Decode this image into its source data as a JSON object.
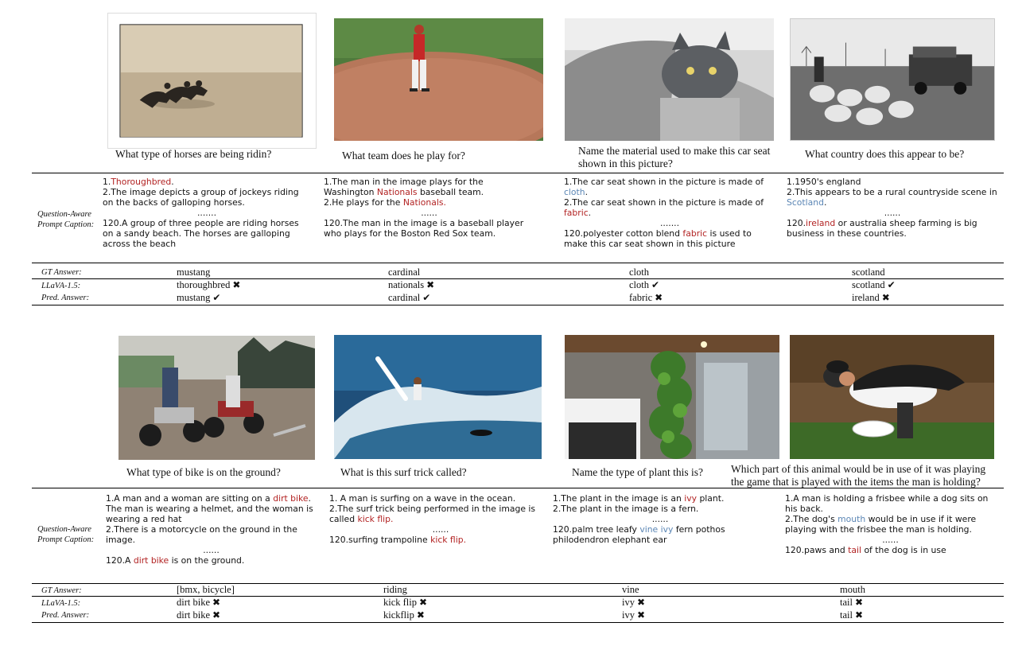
{
  "labels": {
    "caption": "Question-Aware Prompt Caption:",
    "gt": "GT Answer:",
    "llava": "LLaVA-1.5:",
    "pred": "Pred. Answer:"
  },
  "marks": {
    "correct": "✔",
    "wrong": "✖"
  },
  "examples": [
    {
      "image": "horses-racing-on-beach",
      "question": "What type of horses are being ridin?",
      "caption": [
        [
          {
            "t": "1."
          },
          {
            "t": "Thoroughbred",
            "c": "red"
          },
          {
            "t": "."
          }
        ],
        [
          {
            "t": "2.The image depicts a group of jockeys riding on the backs of galloping horses."
          }
        ],
        [
          {
            "t": "......."
          }
        ],
        [
          {
            "t": "120.A group of three people are riding horses on a sandy beach. The horses are galloping across the beach"
          }
        ]
      ],
      "gt": "mustang",
      "llava": "thoroughbred",
      "llava_ok": false,
      "pred": "mustang",
      "pred_ok": true
    },
    {
      "image": "baseball-pitcher-on-mound",
      "question": "What team does he play for?",
      "caption": [
        [
          {
            "t": "1.The man in the image plays for the Washington "
          },
          {
            "t": "Nationals",
            "c": "red"
          },
          {
            "t": " baseball team."
          }
        ],
        [
          {
            "t": "2.He plays for the "
          },
          {
            "t": "Nationals.",
            "c": "red"
          }
        ],
        [
          {
            "t": "......"
          }
        ],
        [
          {
            "t": "120.The man in the image is a baseball player who plays for the Boston Red Sox team."
          }
        ]
      ],
      "gt": "cardinal",
      "llava": "nationals",
      "llava_ok": false,
      "pred": "cardinal",
      "pred_ok": true
    },
    {
      "image": "cat-on-car-seat",
      "question": "Name the material used to make this car seat shown in this picture?",
      "caption": [
        [
          {
            "t": "1.The car seat shown in the picture is made of "
          },
          {
            "t": "cloth",
            "c": "blue"
          },
          {
            "t": "."
          }
        ],
        [
          {
            "t": "2.The car seat shown in the picture is made of "
          },
          {
            "t": "fabric",
            "c": "red"
          },
          {
            "t": "."
          }
        ],
        [
          {
            "t": "......."
          }
        ],
        [
          {
            "t": "120.polyester cotton blend "
          },
          {
            "t": "fabric",
            "c": "red"
          },
          {
            "t": " is used to make this car seat shown in this picture"
          }
        ]
      ],
      "gt": "cloth",
      "llava": "cloth",
      "llava_ok": true,
      "pred": "fabric",
      "pred_ok": false
    },
    {
      "image": "sheep-flock-and-jeep",
      "question": "What country does this appear to be?",
      "caption": [
        [
          {
            "t": "1.1950's england"
          }
        ],
        [
          {
            "t": "2.This appears to be a rural countryside scene in "
          },
          {
            "t": "Scotland",
            "c": "blue"
          },
          {
            "t": "."
          }
        ],
        [
          {
            "t": "......"
          }
        ],
        [
          {
            "t": "120."
          },
          {
            "t": "ireland",
            "c": "red"
          },
          {
            "t": " or australia sheep farming is big business in these countries."
          }
        ]
      ],
      "gt": "scotland",
      "llava": "scotland",
      "llava_ok": true,
      "pred": "ireland",
      "pred_ok": false
    },
    {
      "image": "motocross-riders",
      "question": "What type of bike is on the ground?",
      "caption": [
        [
          {
            "t": "1.A man and a woman are sitting on a "
          },
          {
            "t": "dirt bike",
            "c": "red"
          },
          {
            "t": ". The man is wearing a helmet, and the woman is wearing a red hat"
          }
        ],
        [
          {
            "t": "2.There is a motorcycle on the ground in the image."
          }
        ],
        [
          {
            "t": "......"
          }
        ],
        [
          {
            "t": "120.A "
          },
          {
            "t": "dirt bike",
            "c": "red"
          },
          {
            "t": " is on the ground."
          }
        ]
      ],
      "gt": "[bmx, bicycle]",
      "llava": "dirt bike",
      "llava_ok": false,
      "pred": "dirt bike",
      "pred_ok": false
    },
    {
      "image": "surfer-on-wave",
      "question": "What is this surf trick called?",
      "caption": [
        [
          {
            "t": "1. A man is surfing on a wave in the ocean."
          }
        ],
        [
          {
            "t": "2.The surf trick being performed in the image is called "
          },
          {
            "t": "kick flip.",
            "c": "red"
          }
        ],
        [
          {
            "t": "......"
          }
        ],
        [
          {
            "t": "120.surfing trampoline "
          },
          {
            "t": "kick flip.",
            "c": "red"
          }
        ]
      ],
      "gt": "riding",
      "llava": "kick flip",
      "llava_ok": false,
      "pred": "kickflip",
      "pred_ok": false
    },
    {
      "image": "bathroom-with-plant-wall",
      "question": "Name the type of plant this is?",
      "caption": [
        [
          {
            "t": "1.The plant in the image is an "
          },
          {
            "t": "ivy",
            "c": "red"
          },
          {
            "t": " plant."
          }
        ],
        [
          {
            "t": "2.The plant in the image is a fern."
          }
        ],
        [
          {
            "t": "......"
          }
        ],
        [
          {
            "t": "120.palm tree leafy "
          },
          {
            "t": "vine",
            "c": "blue"
          },
          {
            "t": " "
          },
          {
            "t": "ivy",
            "c": "blue"
          },
          {
            "t": " fern pothos philodendron elephant ear"
          }
        ]
      ],
      "gt": "vine",
      "llava": "ivy",
      "llava_ok": false,
      "pred": "ivy",
      "pred_ok": false
    },
    {
      "image": "dog-on-man-with-frisbee",
      "question": "Which part of this animal would be in use of it was playing the game that is played with the items the man is holding?",
      "caption": [
        [
          {
            "t": "1.A man is holding a frisbee while a dog sits on his back."
          }
        ],
        [
          {
            "t": "2.The dog's "
          },
          {
            "t": "mouth",
            "c": "blue"
          },
          {
            "t": " would be in use if it were playing with the frisbee the man is holding."
          }
        ],
        [
          {
            "t": "......"
          }
        ],
        [
          {
            "t": "120.paws and "
          },
          {
            "t": "tail",
            "c": "red"
          },
          {
            "t": " of the dog is in use"
          }
        ]
      ],
      "gt": "mouth",
      "llava": "tail",
      "llava_ok": false,
      "pred": "tail",
      "pred_ok": false
    }
  ]
}
